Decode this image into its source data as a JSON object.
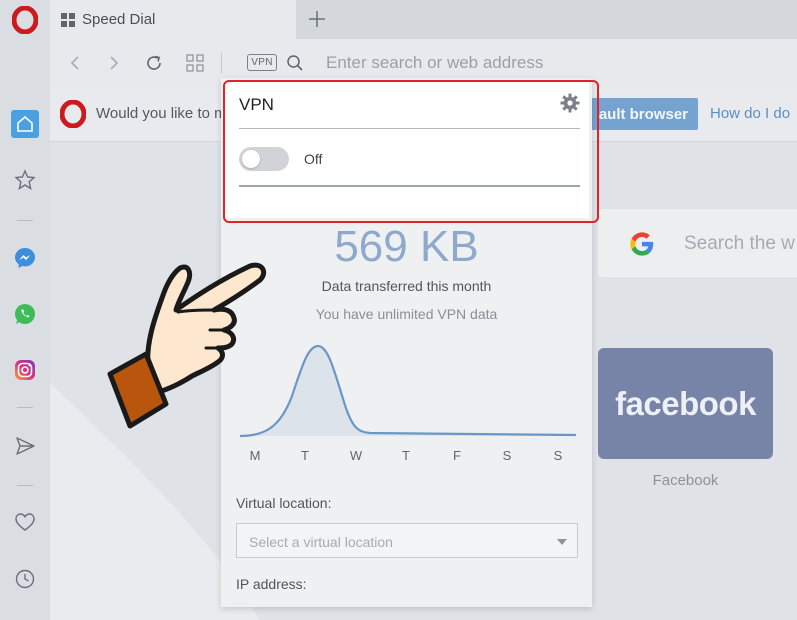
{
  "tab": {
    "title": "Speed Dial"
  },
  "address_bar": {
    "vpn_badge": "VPN",
    "placeholder": "Enter search or web address"
  },
  "infobar": {
    "message": "Would you like to m",
    "default_button": "ault browser",
    "help_link": "How do I do"
  },
  "speed_dial": {
    "search_placeholder": "Search the w",
    "tiles": [
      {
        "logo": "facebook",
        "caption": "Facebook"
      }
    ]
  },
  "vpn_panel": {
    "title": "VPN",
    "toggle_state": "Off",
    "data_amount": "569 KB",
    "data_label": "Data transferred this month",
    "data_sub": "You have unlimited VPN data",
    "days": [
      "M",
      "T",
      "W",
      "T",
      "F",
      "S",
      "S"
    ],
    "virtual_location_label": "Virtual location:",
    "virtual_location_placeholder": "Select a virtual location",
    "ip_label": "IP address:"
  },
  "sidebar": {
    "items": [
      "home-icon",
      "bookmarks-icon",
      "messenger-icon",
      "whatsapp-icon",
      "instagram-icon",
      "send-icon",
      "heart-icon",
      "history-icon"
    ]
  },
  "colors": {
    "highlight": "#e0232a",
    "accent_blue": "#74a3d2",
    "facebook_tile": "#7784a7",
    "opera_red": "#cc1a1f"
  }
}
